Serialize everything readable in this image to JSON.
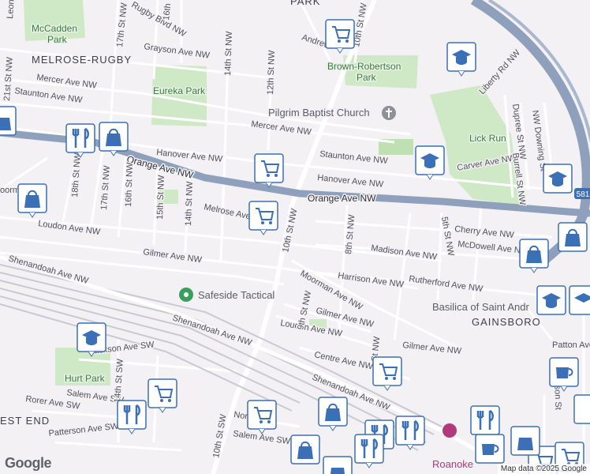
{
  "map": {
    "neighborhoods": [
      "MELROSE-RUGBY",
      "GAINSBORO",
      "EST END",
      "PARK"
    ],
    "parks": [
      "McCadden Park",
      "Eureka Park",
      "Brown-Robertson Park",
      "Lick Run",
      "Hurt Park"
    ],
    "pois": [
      "Pilgrim Baptist Church",
      "Safeside Tactical",
      "Basilica of Saint Andr",
      "Roanoke"
    ],
    "highway_shield": "581",
    "streets": {
      "orange_ave": "Orange Ave NW",
      "orange_ave_left": "Orange Ave NW",
      "shenandoah_1": "Shenandoah Ave NW",
      "shenandoah_2": "Shenandoah Ave NW",
      "shenandoah_3": "Shenandoah Ave NW",
      "tenth_st": "10th St NW",
      "tenth_st_top": "10th St NW",
      "tenth_st_sw": "10th St SW",
      "melrose_ave": "Melrose Ave",
      "loudon_ave": "Loudon Ave NW",
      "loudon_ave_2": "Loudon Ave NW",
      "gilmer_ave": "Gilmer Ave NW",
      "gilmer_ave_2": "Gilmer Ave NW",
      "gilmer_ave_3": "Gilmer Ave NW",
      "moorman_ave": "Moorman Ave NW",
      "harrison_ave": "Harrison Ave NW",
      "rutherford_ave": "Rutherford Ave NW",
      "madison_ave": "Madison Ave NW",
      "mcdowell_ave": "McDowell Ave NW",
      "cherry_ave": "Cherry Ave NW",
      "hanover_ave": "Hanover Ave NW",
      "hanover_ave_2": "Hanover Ave NW",
      "staunton_ave": "Staunton Ave NW",
      "staunton_ave_2": "Staunton Ave NW",
      "mercer_ave": "Mercer Ave NW",
      "mercer_ave_2": "Mercer Ave NW",
      "grayson_ave": "Grayson Ave NW",
      "rugby_blvd": "Rugby Blvd NW",
      "carver_ave": "Carver Ave NW",
      "liberty_rd": "Liberty Rd NW",
      "dupree_st": "Dupree St NW",
      "downing_st": "NW Downing St",
      "burrell_st": "Burrell St NW",
      "centre_ave": "Centre Ave NW",
      "patton_ave": "Patton Ave",
      "jackson_ave": "Jackson Ave SW",
      "salem_ave": "Salem Ave SW",
      "salem_ave_2": "Salem Ave SW",
      "rorer_ave": "Rorer Ave SW",
      "patterson_ave": "Patterson Ave SW",
      "norfolk_ave": "Nor... SW",
      "eighth_st": "8th St NW",
      "ninth_st": "9th St NW",
      "fifth_st": "5th St NW",
      "twelfth_st": "12th St NW",
      "fourteenth_st": "14th St NW",
      "fourteenth_st_2": "14th St NW",
      "fourteenth_st_sw": "14th St SW",
      "fifteenth_st": "15th St NW",
      "sixteenth_st": "16th St NW",
      "sixteenth_st_top": "16th",
      "seventeenth_st": "17th St NW",
      "seventeenth_st_top": "17th St NW",
      "eighteenth_st": "18th St NW",
      "twentyfirst_st": "21st St NW",
      "andrews": "Andrew",
      "leon": "Leon",
      "oorm": "oorm",
      "erson": "erson St",
      "st_nw_right": "St NW"
    }
  },
  "footer": {
    "logo": "Google",
    "credit": "Map data ©2025 Google"
  },
  "colors": {
    "background": "#f3f1f4",
    "park": "#cfe8c5",
    "road": "#ffffff",
    "highway": "#8ea0bb",
    "rail": "#c9cad1",
    "marker": "#3b6fb6"
  }
}
